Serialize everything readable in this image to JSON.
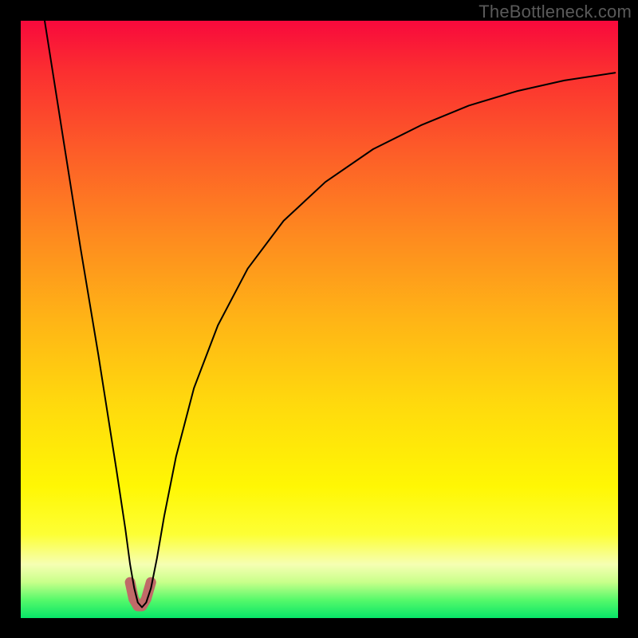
{
  "watermark": "TheBottleneck.com",
  "chart_data": {
    "type": "line",
    "title": "",
    "xlabel": "",
    "ylabel": "",
    "xlim": [
      0,
      100
    ],
    "ylim": [
      0,
      100
    ],
    "grid": false,
    "background_gradient": {
      "direction": "vertical",
      "stops": [
        {
          "pos": 0.0,
          "color": "#f8093c"
        },
        {
          "pos": 0.08,
          "color": "#fb2d31"
        },
        {
          "pos": 0.22,
          "color": "#fd5d28"
        },
        {
          "pos": 0.36,
          "color": "#fe8a1f"
        },
        {
          "pos": 0.5,
          "color": "#ffb416"
        },
        {
          "pos": 0.64,
          "color": "#ffd90d"
        },
        {
          "pos": 0.78,
          "color": "#fff704"
        },
        {
          "pos": 0.86,
          "color": "#fdff35"
        },
        {
          "pos": 0.91,
          "color": "#f6ffb3"
        },
        {
          "pos": 0.94,
          "color": "#c8ff8a"
        },
        {
          "pos": 0.97,
          "color": "#55f96a"
        },
        {
          "pos": 1.0,
          "color": "#07e568"
        }
      ]
    },
    "series": [
      {
        "name": "bottleneck-curve",
        "color": "#000000",
        "x": [
          4.0,
          7.0,
          10.0,
          13.0,
          16.0,
          17.5,
          18.3,
          19.0,
          19.6,
          20.3,
          21.0,
          21.8,
          22.8,
          24.0,
          26.0,
          29.0,
          33.0,
          38.0,
          44.0,
          51.0,
          59.0,
          67.0,
          75.0,
          83.0,
          91.0,
          99.5
        ],
        "y": [
          100.0,
          81.0,
          62.0,
          44.0,
          25.0,
          15.0,
          9.0,
          5.0,
          2.6,
          1.8,
          2.6,
          5.0,
          10.0,
          17.0,
          27.0,
          38.5,
          49.0,
          58.5,
          66.5,
          73.0,
          78.5,
          82.5,
          85.8,
          88.2,
          90.0,
          91.3
        ]
      }
    ],
    "highlight_segment": {
      "color": "#c06a68",
      "x": [
        18.3,
        18.9,
        19.6,
        20.3,
        21.0,
        21.8
      ],
      "y": [
        6.0,
        3.2,
        2.0,
        2.0,
        3.2,
        6.0
      ]
    }
  }
}
